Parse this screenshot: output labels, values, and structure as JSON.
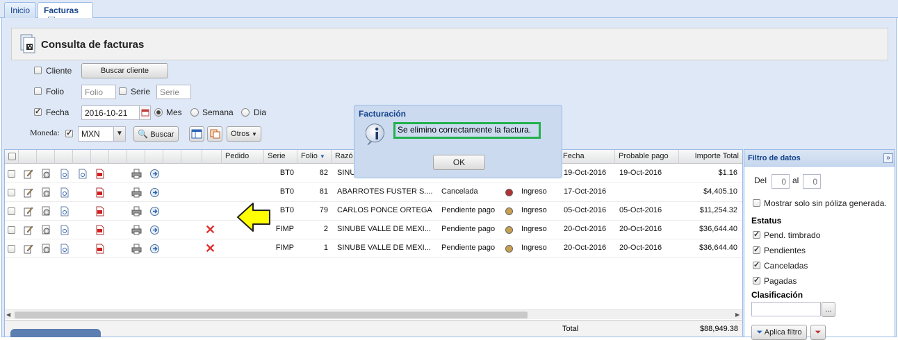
{
  "tabs": [
    {
      "label": "Inicio",
      "active": false
    },
    {
      "label": "Facturas",
      "active": true,
      "closable": true
    }
  ],
  "panel": {
    "title": "Consulta de facturas"
  },
  "filters": {
    "cliente_label": "Cliente",
    "buscar_cliente_label": "Buscar cliente",
    "folio_label": "Folio",
    "folio_placeholder": "Folio",
    "serie_label": "Serie",
    "serie_placeholder": "Serie",
    "fecha_label": "Fecha",
    "fecha_value": "2016-10-21",
    "fecha_checked": true,
    "periodo": [
      {
        "label": "Mes",
        "selected": true
      },
      {
        "label": "Semana",
        "selected": false
      },
      {
        "label": "Dia",
        "selected": false
      }
    ],
    "moneda_label": "Moneda:",
    "moneda_value": "MXN",
    "buscar_label": "Buscar",
    "otros_label": "Otros"
  },
  "grid": {
    "columns": [
      "Pedido",
      "Serie",
      "Folio",
      "Razó",
      "Fecha",
      "Probable pago",
      "Importe Total"
    ],
    "rows": [
      {
        "serie": "BT0",
        "folio": "82",
        "razon": "SINUB",
        "estatus": "",
        "dot": "",
        "tipo": "",
        "fecha": "19-Oct-2016",
        "probable": "19-Oct-2016",
        "importe": "$1.16",
        "cancel": false
      },
      {
        "serie": "BT0",
        "folio": "81",
        "razon": "ABARROTES FUSTER S....",
        "estatus": "Cancelada",
        "dot": "#b03232",
        "tipo": "Ingreso",
        "fecha": "17-Oct-2016",
        "probable": "",
        "importe": "$4,405.10",
        "cancel": false
      },
      {
        "serie": "BT0",
        "folio": "79",
        "razon": "CARLOS PONCE ORTEGA",
        "estatus": "Pendiente pago",
        "dot": "#c8a050",
        "tipo": "Ingreso",
        "fecha": "05-Oct-2016",
        "probable": "05-Oct-2016",
        "importe": "$11,254.32",
        "cancel": false
      },
      {
        "serie": "FIMP",
        "folio": "2",
        "razon": "SINUBE VALLE DE MEXI...",
        "estatus": "Pendiente pago",
        "dot": "#c8a050",
        "tipo": "Ingreso",
        "fecha": "20-Oct-2016",
        "probable": "20-Oct-2016",
        "importe": "$36,644.40",
        "cancel": true
      },
      {
        "serie": "FIMP",
        "folio": "1",
        "razon": "SINUBE VALLE DE MEXI...",
        "estatus": "Pendiente pago",
        "dot": "#c8a050",
        "tipo": "Ingreso",
        "fecha": "20-Oct-2016",
        "probable": "20-Oct-2016",
        "importe": "$36,644.40",
        "cancel": true
      }
    ],
    "total_label": "Total",
    "total_value": "$88,949.38"
  },
  "filtro": {
    "title": "Filtro de datos",
    "del_label": "Del",
    "del_value": "0",
    "al_label": "al",
    "al_value": "0",
    "mostrar_label": "Mostrar solo sin póliza generada.",
    "estatus_title": "Estatus",
    "estatus": [
      {
        "label": "Pend. timbrado",
        "checked": true
      },
      {
        "label": "Pendientes",
        "checked": true
      },
      {
        "label": "Canceladas",
        "checked": true
      },
      {
        "label": "Pagadas",
        "checked": true
      }
    ],
    "clasificacion_title": "Clasificación",
    "ellipsis_label": "...",
    "aplica_label": "Aplica filtro"
  },
  "dialog": {
    "title": "Facturación",
    "message": "Se elimino correctamente la factura.",
    "ok_label": "OK"
  }
}
